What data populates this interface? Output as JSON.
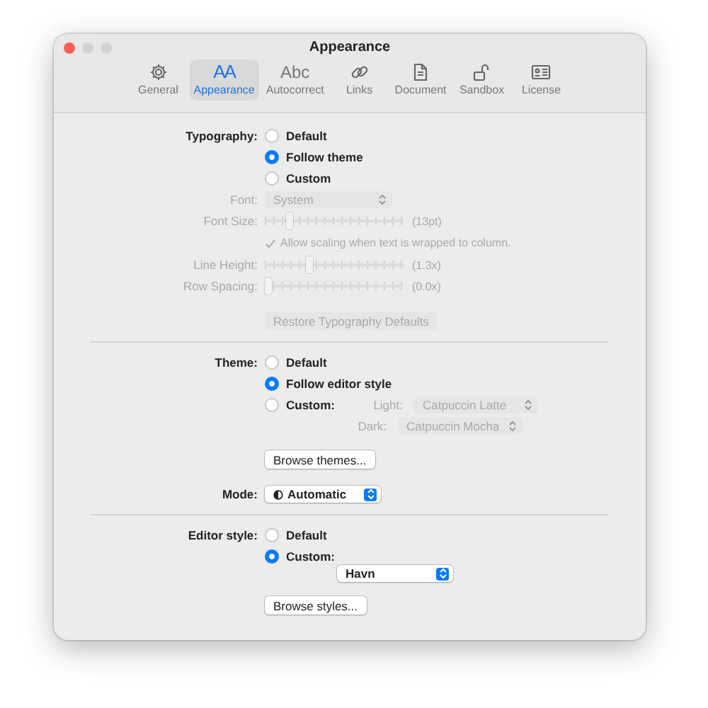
{
  "window": {
    "title": "Appearance"
  },
  "toolbar": [
    {
      "label": "General",
      "selected": false,
      "kind": "gear"
    },
    {
      "label": "Appearance",
      "selected": true,
      "kind": "glyph",
      "glyph": "AA"
    },
    {
      "label": "Autocorrect",
      "selected": false,
      "kind": "glyph",
      "glyph": "Abc"
    },
    {
      "label": "Links",
      "selected": false,
      "kind": "link"
    },
    {
      "label": "Document",
      "selected": false,
      "kind": "document"
    },
    {
      "label": "Sandbox",
      "selected": false,
      "kind": "lock"
    },
    {
      "label": "License",
      "selected": false,
      "kind": "card"
    }
  ],
  "typography": {
    "label": "Typography:",
    "options": [
      {
        "label": "Default",
        "selected": false
      },
      {
        "label": "Follow theme",
        "selected": true
      },
      {
        "label": "Custom",
        "selected": false
      }
    ],
    "font": {
      "label": "Font:",
      "value": "System",
      "disabled": true
    },
    "sliders": [
      {
        "label": "Font Size:",
        "level": 0.16,
        "reading": "(13pt)",
        "disabled": true
      },
      {
        "label": "Line Height:",
        "level": 0.31,
        "reading": "(1.3x)",
        "disabled": true
      },
      {
        "label": "Row Spacing:",
        "level": 0,
        "reading": "(0.0x)",
        "disabled": true
      }
    ],
    "scaling": {
      "label": "Allow scaling when text is wrapped to column.",
      "checked": true,
      "disabled": true
    },
    "restore_button": {
      "label": "Restore Typography Defaults",
      "disabled": true
    }
  },
  "theme": {
    "label": "Theme:",
    "options": [
      {
        "label": "Default",
        "selected": false
      },
      {
        "label": "Follow editor style",
        "selected": true
      },
      {
        "label": "Custom:",
        "selected": false
      }
    ],
    "light": {
      "label": "Light:",
      "value": "Catpuccin Latte",
      "disabled": true
    },
    "dark": {
      "label": "Dark:",
      "value": "Catpuccin Mocha",
      "disabled": true
    },
    "browse_button": {
      "label": "Browse themes..."
    }
  },
  "mode": {
    "label": "Mode:",
    "value": "Automatic"
  },
  "editor_style": {
    "label": "Editor style:",
    "options": [
      {
        "label": "Default",
        "selected": false
      },
      {
        "label": "Custom:",
        "selected": true
      }
    ],
    "value": "Havn",
    "browse_button": {
      "label": "Browse styles..."
    }
  }
}
